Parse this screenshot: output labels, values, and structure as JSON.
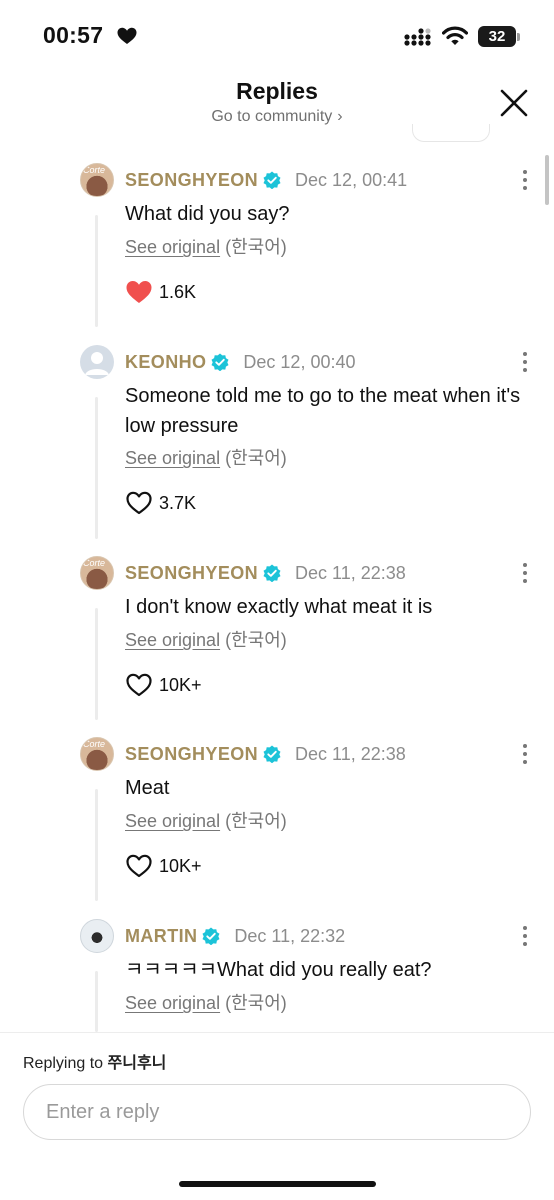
{
  "status_bar": {
    "time": "00:57",
    "battery": "32",
    "icons": [
      "heart-icon",
      "signal-icon",
      "wifi-icon",
      "battery-icon"
    ]
  },
  "header": {
    "title": "Replies",
    "subtitle": "Go to community",
    "subtitle_chevron": "›",
    "close_icon": "close-icon"
  },
  "comments": [
    {
      "author": "SEONGHYEON",
      "avatar_text": "Corte",
      "timestamp": "Dec 12, 00:41",
      "text": "What did you say?",
      "see_original": "See original",
      "language": "(한국어)",
      "likes": "1.6K",
      "liked": true
    },
    {
      "author": "KEONHO",
      "timestamp": "Dec 12, 00:40",
      "text": "Someone told me to go to the meat when it's low pressure",
      "see_original": "See original",
      "language": "(한국어)",
      "likes": "3.7K",
      "liked": false
    },
    {
      "author": "SEONGHYEON",
      "avatar_text": "Corte",
      "timestamp": "Dec 11, 22:38",
      "text": "I don't know exactly what meat it is",
      "see_original": "See original",
      "language": "(한국어)",
      "likes": "10K+",
      "liked": false
    },
    {
      "author": "SEONGHYEON",
      "avatar_text": "Corte",
      "timestamp": "Dec 11, 22:38",
      "text": "Meat",
      "see_original": "See original",
      "language": "(한국어)",
      "likes": "10K+",
      "liked": false
    },
    {
      "author": "MARTIN",
      "timestamp": "Dec 11, 22:32",
      "text": "ㅋㅋㅋㅋㅋWhat did you really eat?",
      "see_original": "See original",
      "language": "(한국어)"
    }
  ],
  "reply": {
    "prefix": "Replying to",
    "target": "쭈니후니",
    "placeholder": "Enter a reply"
  },
  "colors": {
    "author_name": "#a38d5c",
    "verified_badge": "#1cc3d8",
    "liked_heart": "#f0504e",
    "timestamp": "#8c8c8c"
  }
}
